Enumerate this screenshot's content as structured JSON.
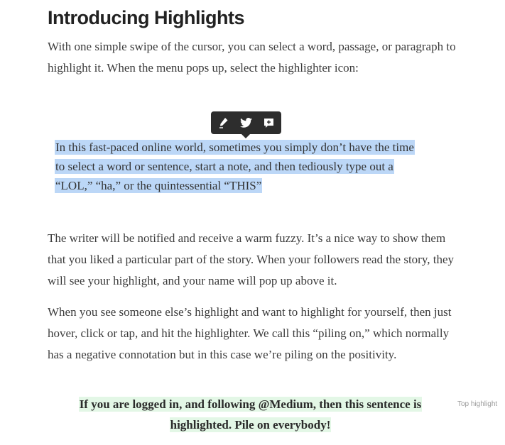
{
  "article": {
    "title": "Introducing Highlights",
    "intro": "With one simple swipe of the cursor, you can select a word, passage, or paragraph to highlight it. When the menu pops up, select the highlighter icon:",
    "toolbar": {
      "icons": [
        "highlighter-icon",
        "twitter-icon",
        "respond-icon"
      ]
    },
    "highlight_example": {
      "line1": "In this fast-paced online world, sometimes you simply don’t have the time",
      "line2": "to select a word or sentence, start a note, and then tediously type out a",
      "line3": "“LOL,” “ha,” or the quintessential “THIS”"
    },
    "paragraph2": "The writer will be notified and receive a warm fuzzy. It’s a nice way to show them that you liked a particular part of the story. When your followers read the story, they will see your highlight, and your name will pop up above it.",
    "paragraph3": "When you see someone else’s highlight and want to highlight for yourself, then just hover, click or tap, and hit the highlighter. We call this “piling on,” which normally has a negative connotation but in this case we’re piling on the positivity.",
    "top_highlight": {
      "line1": "If you are logged in, and following @Medium, then this sentence is",
      "line2": "highlighted. Pile on everybody!",
      "label": "Top highlight"
    }
  },
  "colors": {
    "selection": "#bcd7f7",
    "top_highlight_bg": "#e3f7e6",
    "toolbar_bg": "#2d2d2d"
  }
}
